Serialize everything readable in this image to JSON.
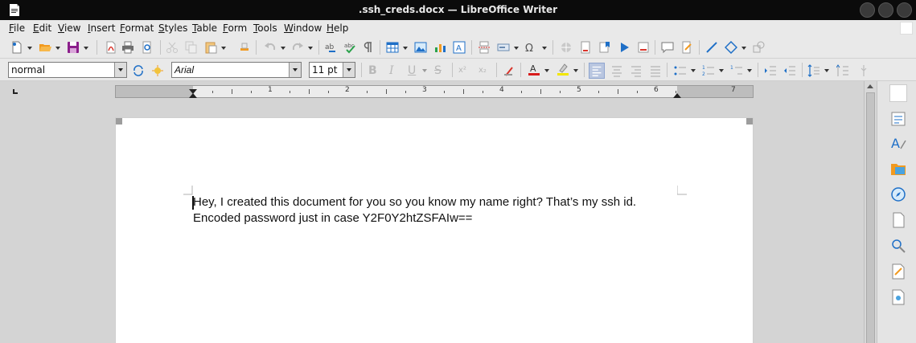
{
  "window": {
    "title": ".ssh_creds.docx — LibreOffice Writer"
  },
  "menu": [
    {
      "key": "file",
      "first": "F",
      "rest": "ile"
    },
    {
      "key": "edit",
      "first": "E",
      "rest": "dit"
    },
    {
      "key": "view",
      "first": "V",
      "rest": "iew"
    },
    {
      "key": "insert",
      "first": "I",
      "rest": "nsert"
    },
    {
      "key": "format",
      "first": "F",
      "rest": "ormat"
    },
    {
      "key": "styles",
      "first": "S",
      "rest": "tyles"
    },
    {
      "key": "table",
      "first": "T",
      "rest": "able"
    },
    {
      "key": "form",
      "first": "F",
      "rest": "orm"
    },
    {
      "key": "tools",
      "first": "T",
      "rest": "ools"
    },
    {
      "key": "window",
      "first": "W",
      "rest": "indow"
    },
    {
      "key": "help",
      "first": "H",
      "rest": "elp"
    }
  ],
  "formatting": {
    "paragraph_style": "normal",
    "font_name": "Arial",
    "font_size": "11 pt",
    "bold_label": "B",
    "italic_label": "I",
    "underline_label": "U",
    "strike_label": "S",
    "superscript_label": "x²",
    "subscript_label": "x₂"
  },
  "ruler": {
    "numbers": [
      "1",
      "2",
      "3",
      "4",
      "5",
      "6",
      "7"
    ]
  },
  "document": {
    "line1": "Hey, I created this document for you so you know my name right? That’s my ssh id.",
    "line2": "Encoded password just in case  Y2F0Y2htZSFAIw=="
  },
  "colors": {
    "accent_blue": "#1e6fc7",
    "save_purple": "#8b1f8b",
    "font_color_red": "#d81b1b",
    "highlight_yellow": "#f2e600",
    "pdf_red": "#d9342b"
  }
}
